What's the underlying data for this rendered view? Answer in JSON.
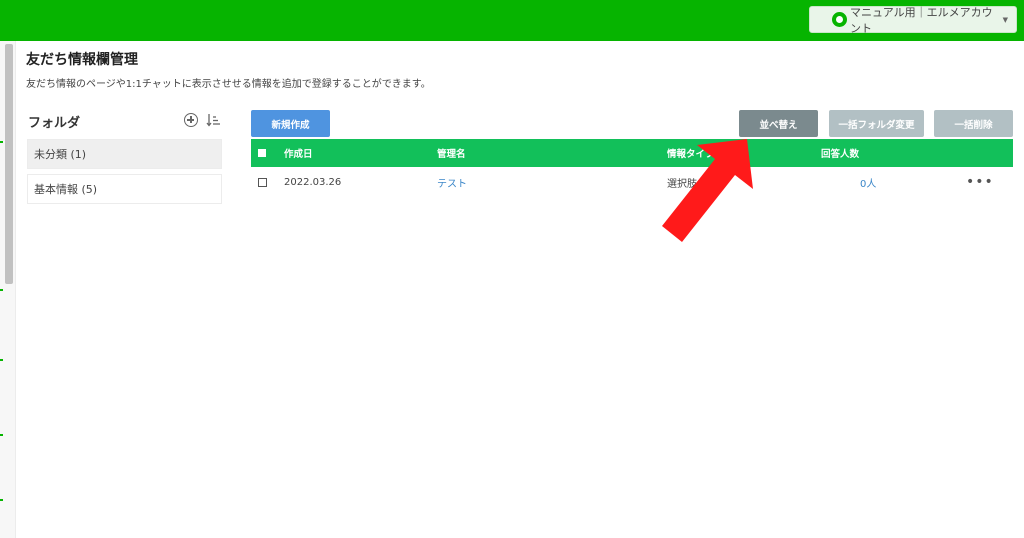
{
  "header": {
    "account_label": "マニュアル用｜エルメアカウント"
  },
  "page": {
    "title": "友だち情報欄管理",
    "description": "友だち情報のページや1:1チャットに表示させせる情報を追加で登録することができます。"
  },
  "folders": {
    "title": "フォルダ",
    "items": [
      {
        "label": "未分類 (1)",
        "active": true
      },
      {
        "label": "基本情報 (5)",
        "active": false
      }
    ]
  },
  "toolbar": {
    "new_label": "新規作成",
    "sort_label": "並べ替え",
    "bulk_folder_label": "一括フォルダ変更",
    "bulk_delete_label": "一括削除"
  },
  "table": {
    "columns": [
      "作成日",
      "管理名",
      "情報タイプ",
      "回答人数"
    ],
    "rows": [
      {
        "date": "2022.03.26",
        "name": "テスト",
        "type": "選択肢",
        "count": "0人"
      }
    ]
  },
  "colors": {
    "brand_green": "#06b400",
    "table_header": "#12c05a",
    "primary_button": "#4f94e0",
    "arrow": "#ff1a1a"
  }
}
